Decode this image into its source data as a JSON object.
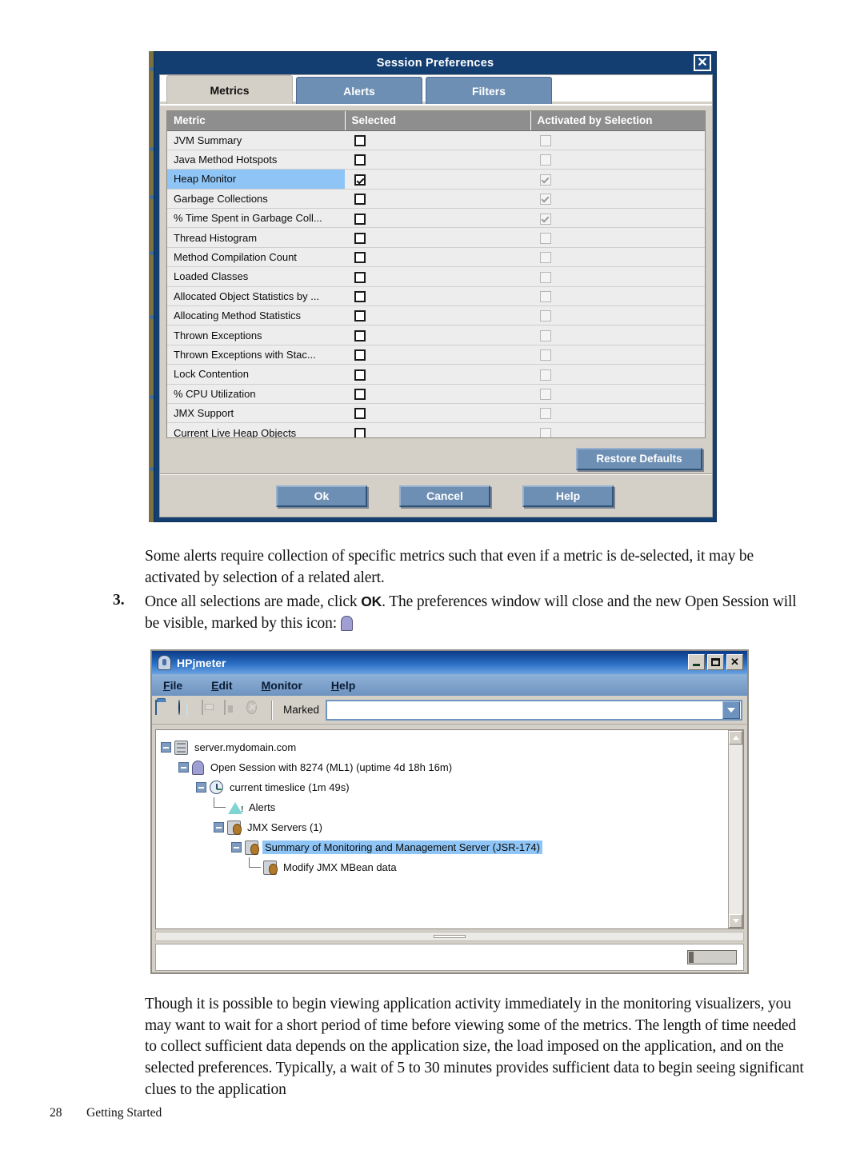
{
  "dialog": {
    "title": "Session Preferences",
    "close_label": "✕",
    "tabs": [
      {
        "label": "Metrics",
        "active": true
      },
      {
        "label": "Alerts",
        "active": false
      },
      {
        "label": "Filters",
        "active": false
      }
    ],
    "table": {
      "columns": [
        "Metric",
        "Selected",
        "Activated by Selection"
      ],
      "rows": [
        {
          "metric": "JVM Summary",
          "selected": false,
          "activated": false,
          "highlighted": false
        },
        {
          "metric": "Java Method Hotspots",
          "selected": false,
          "activated": false,
          "highlighted": false
        },
        {
          "metric": "Heap Monitor",
          "selected": true,
          "activated": true,
          "highlighted": true
        },
        {
          "metric": "Garbage Collections",
          "selected": false,
          "activated": true,
          "highlighted": false
        },
        {
          "metric": "% Time Spent in Garbage Coll...",
          "selected": false,
          "activated": true,
          "highlighted": false
        },
        {
          "metric": "Thread Histogram",
          "selected": false,
          "activated": false,
          "highlighted": false
        },
        {
          "metric": "Method Compilation Count",
          "selected": false,
          "activated": false,
          "highlighted": false
        },
        {
          "metric": "Loaded Classes",
          "selected": false,
          "activated": false,
          "highlighted": false
        },
        {
          "metric": "Allocated Object Statistics by ...",
          "selected": false,
          "activated": false,
          "highlighted": false
        },
        {
          "metric": "Allocating Method Statistics",
          "selected": false,
          "activated": false,
          "highlighted": false
        },
        {
          "metric": "Thrown Exceptions",
          "selected": false,
          "activated": false,
          "highlighted": false
        },
        {
          "metric": "Thrown Exceptions with Stac...",
          "selected": false,
          "activated": false,
          "highlighted": false
        },
        {
          "metric": "Lock Contention",
          "selected": false,
          "activated": false,
          "highlighted": false
        },
        {
          "metric": "% CPU Utilization",
          "selected": false,
          "activated": false,
          "highlighted": false
        },
        {
          "metric": "JMX Support",
          "selected": false,
          "activated": false,
          "highlighted": false
        },
        {
          "metric": "Current Live Heap Objects",
          "selected": false,
          "activated": false,
          "highlighted": false
        }
      ]
    },
    "restore_defaults_label": "Restore Defaults",
    "buttons": [
      {
        "label": "Ok"
      },
      {
        "label": "Cancel"
      },
      {
        "label": "Help"
      }
    ]
  },
  "text": {
    "para1": "Some alerts require collection of specific metrics such that even if a metric is de-selected, it may be activated by selection of a related alert.",
    "step_number": "3.",
    "step_before": "Once all selections are made, click ",
    "step_bold": "OK",
    "step_after": ". The preferences window will close and the new Open Session will be visible, marked by this icon:",
    "para3": "Though it is possible to begin viewing application activity immediately in the monitoring visualizers, you may want to wait for a short period of time before viewing some of the metrics. The length of time needed to collect sufficient data depends on the application size, the load imposed on the application, and on the selected preferences. Typically, a wait of 5 to 30 minutes provides sufficient data to begin seeing significant clues to the application"
  },
  "hpjmeter": {
    "title": "HPjmeter",
    "window_buttons": {
      "minimize": "",
      "maximize": "",
      "close": "✕"
    },
    "menus": [
      {
        "mnemonic": "F",
        "rest": "ile"
      },
      {
        "mnemonic": "E",
        "rest": "dit"
      },
      {
        "mnemonic": "M",
        "rest": "onitor"
      },
      {
        "mnemonic": "H",
        "rest": "elp"
      }
    ],
    "toolbar": {
      "icons": [
        "open-folder-icon",
        "globe-icon",
        "save-icon",
        "export-icon",
        "close-session-icon"
      ],
      "marked_label": "Marked",
      "combo_value": ""
    },
    "tree": [
      {
        "indent": 0,
        "label": "server.mydomain.com",
        "icon": "server-icon",
        "toggle": "minus",
        "selected": false
      },
      {
        "indent": 1,
        "label": "Open Session with 8274 (ML1) (uptime 4d 18h 16m)",
        "icon": "arch-icon",
        "toggle": "minus",
        "selected": false
      },
      {
        "indent": 2,
        "label": "current timeslice (1m 49s)",
        "icon": "clock-icon",
        "toggle": "minus",
        "selected": false
      },
      {
        "indent": 3,
        "label": "Alerts",
        "icon": "alert-icon",
        "toggle": "none",
        "selected": false
      },
      {
        "indent": 3,
        "label": "JMX Servers (1)",
        "icon": "jmx-icon",
        "toggle": "minus",
        "selected": false
      },
      {
        "indent": 4,
        "label": "Summary of Monitoring and Management Server (JSR-174)",
        "icon": "jmx-icon",
        "toggle": "minus",
        "selected": true
      },
      {
        "indent": 5,
        "label": "Modify JMX MBean data",
        "icon": "jmx-icon",
        "toggle": "none",
        "selected": false
      }
    ]
  },
  "footer": {
    "page_number": "28",
    "section": "Getting Started"
  }
}
